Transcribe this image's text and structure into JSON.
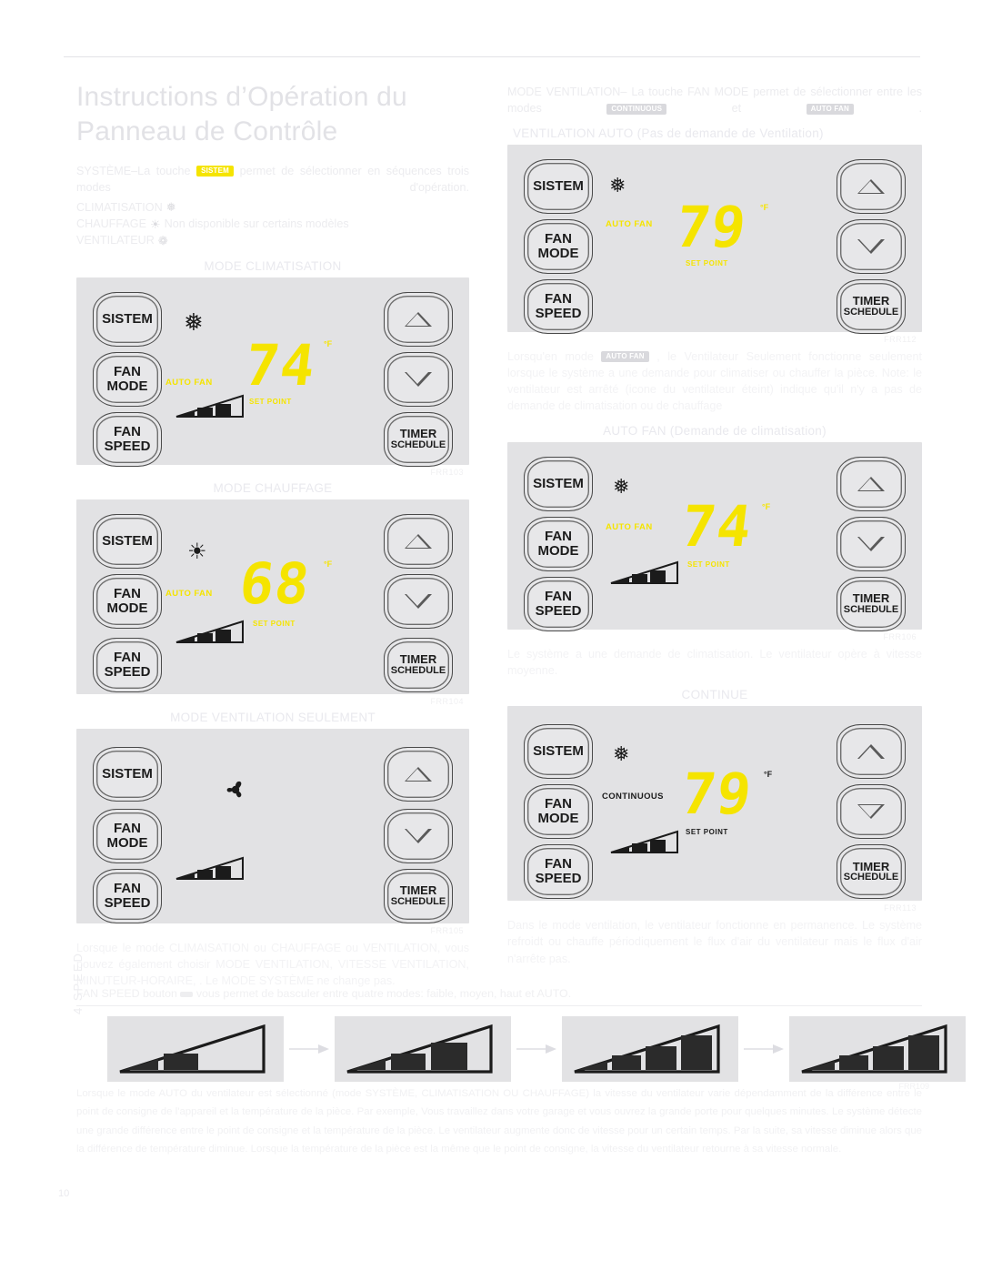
{
  "page": {
    "number": "10",
    "title_line1": "Instructions d’Opération du",
    "title_line2": "Panneau de Contrôle"
  },
  "left_column": {
    "systeme_intro": {
      "prefix": "SYSTÈME–La touche",
      "badge": "SISTEM",
      "suffix": "permet de sélectionner en séquences trois modes d'opération."
    },
    "mode_list": [
      {
        "label": "CLIMATISATION",
        "icon": "snowflake-icon",
        "glyph": "❅",
        "note": ""
      },
      {
        "label": "CHAUFFAGE",
        "icon": "sun-icon",
        "glyph": "☀",
        "note": "Non disponible sur certains modèles"
      },
      {
        "label": "VENTILATEUR",
        "icon": "fan-icon",
        "glyph": "❁",
        "note": ""
      }
    ],
    "panels": [
      {
        "caption": "MODE CLIMATISATION",
        "code": "FRR103",
        "icon": "snowflake-icon",
        "fan_mode_label": "AUTO FAN",
        "fan_mode_color": "#f5e400",
        "temperature": "74",
        "degree": "°F",
        "set_point": "SET POINT",
        "fan_bars": 3,
        "show_wedge": true,
        "buttons": {
          "sistem": "SISTEM",
          "fan_mode_l1": "FAN",
          "fan_mode_l2": "MODE",
          "fan_speed_l1": "FAN",
          "fan_speed_l2": "SPEED",
          "timer_l1": "TIMER",
          "timer_l2": "SCHEDULE",
          "up": "up-triangle-icon",
          "down": "down-triangle-icon"
        }
      },
      {
        "caption": "MODE CHAUFFAGE",
        "code": "FRR104",
        "icon": "sun-icon",
        "fan_mode_label": "AUTO FAN",
        "fan_mode_color": "#f5e400",
        "temperature": "68",
        "degree": "°F",
        "set_point": "SET POINT",
        "fan_bars": 3,
        "show_wedge": true,
        "buttons": {
          "sistem": "SISTEM",
          "fan_mode_l1": "FAN",
          "fan_mode_l2": "MODE",
          "fan_speed_l1": "FAN",
          "fan_speed_l2": "SPEED",
          "timer_l1": "TIMER",
          "timer_l2": "SCHEDULE",
          "up": "up-triangle-icon",
          "down": "down-triangle-icon"
        }
      },
      {
        "caption": "MODE VENTILATION SEULEMENT",
        "code": "FRR105",
        "icon": "fan-icon",
        "fan_mode_label": "",
        "fan_mode_color": "#f5e400",
        "temperature": "",
        "degree": "",
        "set_point": "",
        "fan_bars": 3,
        "show_wedge": true,
        "buttons": {
          "sistem": "SISTEM",
          "fan_mode_l1": "FAN",
          "fan_mode_l2": "MODE",
          "fan_speed_l1": "FAN",
          "fan_speed_l2": "SPEED",
          "timer_l1": "TIMER",
          "timer_l2": "SCHEDULE",
          "up": "up-triangle-icon",
          "down": "down-triangle-icon"
        }
      }
    ],
    "closing_paragraph": "Lorsque le mode CLIMAISATION  ou CHAUFFAGE ou VENTILATION, vous pouvez également choisir MODE VENTILATION, VITESSE VENTILATION, MINUTEUR-HORAIRE, . Le MODE SYSTÈME ne change pas."
  },
  "right_column": {
    "fan_mode_intro": {
      "prefix": "MODE VENTILATION–  La touche FAN MODE permet de sélectionner entre les modes",
      "badge1": "CONTINUOUS",
      "mid": "et",
      "badge2": "AUTO FAN",
      "suffix": "."
    },
    "panels": [
      {
        "caption": "VENTILATION AUTO (Pas de demande de Ventilation)",
        "code": "FRR112",
        "icon": "snowflake-icon",
        "fan_mode_label": "AUTO FAN",
        "fan_mode_color": "#f5e400",
        "temperature": "79",
        "degree": "°F",
        "set_point": "SET POINT",
        "fan_bars": 0,
        "show_wedge": false,
        "buttons": {
          "sistem": "SISTEM",
          "fan_mode_l1": "FAN",
          "fan_mode_l2": "MODE",
          "fan_speed_l1": "FAN",
          "fan_speed_l2": "SPEED",
          "timer_l1": "TIMER",
          "timer_l2": "SCHEDULE",
          "up": "up-triangle-icon",
          "down": "down-triangle-icon"
        }
      },
      {
        "caption": "AUTO FAN (Demande de climatisation)",
        "code": "FRR106",
        "icon": "snowflake-icon",
        "fan_mode_label": "AUTO FAN",
        "fan_mode_color": "#f5e400",
        "temperature": "74",
        "degree": "°F",
        "set_point": "SET POINT",
        "fan_bars": 3,
        "show_wedge": true,
        "buttons": {
          "sistem": "SISTEM",
          "fan_mode_l1": "FAN",
          "fan_mode_l2": "MODE",
          "fan_speed_l1": "FAN",
          "fan_speed_l2": "SPEED",
          "timer_l1": "TIMER",
          "timer_l2": "SCHEDULE",
          "up": "up-triangle-icon",
          "down": "down-triangle-icon"
        }
      },
      {
        "caption": "CONTINUE",
        "code": "FRR113",
        "icon": "snowflake-icon",
        "fan_mode_label": "CONTINUOUS",
        "fan_mode_color": "#1b1b1b",
        "temperature": "79",
        "degree": "°F",
        "set_point": "SET POINT",
        "fan_bars": 3,
        "show_wedge": true,
        "buttons": {
          "sistem": "SISTEM",
          "fan_mode_l1": "FAN",
          "fan_mode_l2": "MODE",
          "fan_speed_l1": "FAN",
          "fan_speed_l2": "SPEED",
          "timer_l1": "TIMER",
          "timer_l2": "SCHEDULE",
          "up": "up-triangle-icon",
          "down": "down-triangle-icon"
        }
      }
    ],
    "auto_fan_note_prefix": "Lorsqu'en mode",
    "auto_fan_note_badge": "AUTO FAN",
    "auto_fan_note_suffix": ", le Ventilateur Seulement fonctionne seulement lorsque le système a une demande pour climatiser ou chauffer la pièce. Note: le ventilateur est arrêté (icone du ventilateur éteint) indique qu'il n'y a pas de demande de climatisation ou de chauffage",
    "cooling_demand_note": "Le système a une demande de climatisation. Le ventilateur opère à vitesse moyenne.",
    "continuous_note": "Dans le mode ventilation, le ventilateur fonctionne en permanence. Le système refroidt ou chauffe périodiquement le flux d'air du ventilateur mais le flux d'air n'arrête pas."
  },
  "fan_speed_section": {
    "lead_prefix": "FAN SPEED",
    "lead_mid": "bouton",
    "lead_badge": "",
    "lead_suffix": "vous permet de basculer entre quatre modes: faible, moyen, haut et AUTO.",
    "vertical_label": "4 SPEED",
    "code": "FRR109",
    "steps": [
      {
        "name": "faible",
        "bars": 2
      },
      {
        "name": "moyen",
        "bars": 3
      },
      {
        "name": "haut",
        "bars": 4
      },
      {
        "name": "AUTO",
        "bars": 4
      }
    ],
    "footer_paragraph": "Lorsque le mode AUTO du ventilateur est sélectionné (mode SYSTÈME, CLIMATISATION OU CHAUFFAGE) la vitesse du ventilateur varie dépendamment de la différence entre le point de consigne de l'appareil et la température de la pièce. Par exemple, Vous travaillez dans votre garage et vous ouvrez la grande porte pour quelques minutes. Le système détecte une grande différence entre le point de consigne et la température de la pièce. Le ventilateur augmente donc de vitesse pour un certain temps. Par la suite, sa vitesse diminue alors que la différence de température diminue. Lorsque la température de la pièce est la même que le point de consigne, la vitesse du ventilateur retourne à sa vitesse normale."
  }
}
